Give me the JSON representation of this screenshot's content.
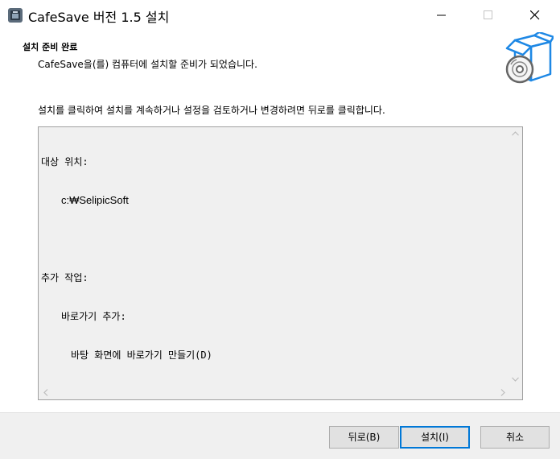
{
  "window": {
    "title": "CafeSave 버전 1.5 설치"
  },
  "header": {
    "title": "설치 준비 완료",
    "subtitle": "CafeSave을(를) 컴퓨터에 설치할 준비가 되었습니다."
  },
  "instruction": "설치를 클릭하여 설치를 계속하거나 설정을 검토하거나 변경하려면 뒤로를 클릭합니다.",
  "summary": {
    "dest_label": "대상 위치:",
    "dest_path": "c:₩SelipicSoft",
    "tasks_label": "추가 작업:",
    "shortcut_group": "바로가기 추가:",
    "shortcut_desktop": "바탕 화면에 바로가기 만들기(D)"
  },
  "buttons": {
    "back": "뒤로(B)",
    "install": "설치(I)",
    "cancel": "취소"
  },
  "colors": {
    "accent": "#0078d7",
    "footer_bg": "#f0f0f0",
    "memo_bg": "#f0f0f0"
  },
  "icons": {
    "app": "installer-app-icon",
    "header": "box-disc-icon"
  }
}
